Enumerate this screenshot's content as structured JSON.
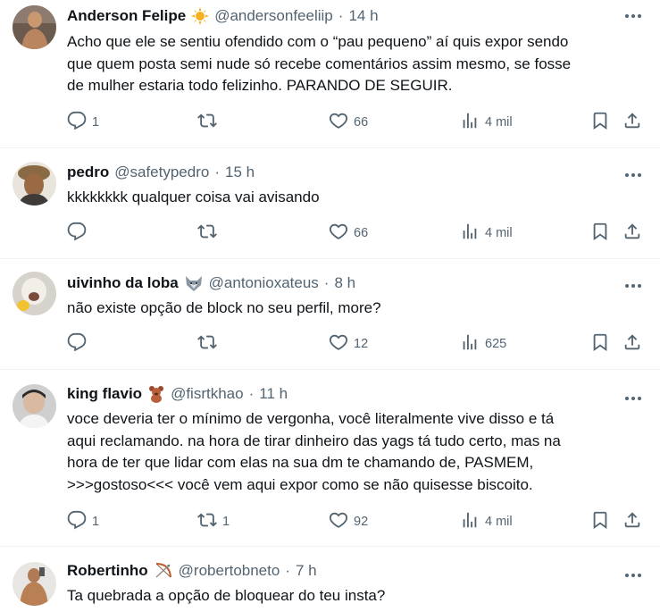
{
  "colors": {
    "text": "#0f1419",
    "secondary": "#536471",
    "divider": "#eff3f4"
  },
  "tweets": [
    {
      "name": "Anderson Felipe",
      "badge_icon": "sun-emoji",
      "handle": "@andersonfeeliip",
      "time": "14 h",
      "text": "Acho que ele se sentiu ofendido com o “pau pequeno” aí quis expor sendo\nque quem posta semi nude só recebe comentários assim mesmo, se fosse\nde mulher estaria todo felizinho. PARANDO DE SEGUIR.",
      "replies": "1",
      "retweets": "",
      "likes": "66",
      "views": "4 mil"
    },
    {
      "name": "pedro",
      "badge_icon": "",
      "handle": "@safetypedro",
      "time": "15 h",
      "text": "kkkkkkkk qualquer coisa vai avisando",
      "replies": "",
      "retweets": "",
      "likes": "66",
      "views": "4 mil"
    },
    {
      "name": "uivinho da loba",
      "badge_icon": "wolf-emoji",
      "handle": "@antonioxateus",
      "time": "8 h",
      "text": "não existe opção de block no seu perfil, more?",
      "replies": "",
      "retweets": "",
      "likes": "12",
      "views": "625"
    },
    {
      "name": "king flavio",
      "badge_icon": "teddy-bear-emoji",
      "handle": "@fisrtkhao",
      "time": "11 h",
      "text": "voce deveria ter o mínimo de vergonha, você literalmente vive disso e tá\naqui reclamando. na hora de tirar dinheiro das yags tá tudo certo, mas na\nhora de ter que lidar com elas na sua dm te chamando de, PASMEM,\n>>>gostoso<<< você vem aqui expor como se não quisesse biscoito.",
      "replies": "1",
      "retweets": "1",
      "likes": "92",
      "views": "4 mil"
    },
    {
      "name": "Robertinho",
      "badge_icon": "bow-and-arrow-emoji",
      "handle": "@robertobneto",
      "time": "7 h",
      "text": "Ta quebrada a opção de bloquear do teu insta?",
      "replies": "",
      "retweets": "",
      "likes": "",
      "views": ""
    }
  ]
}
